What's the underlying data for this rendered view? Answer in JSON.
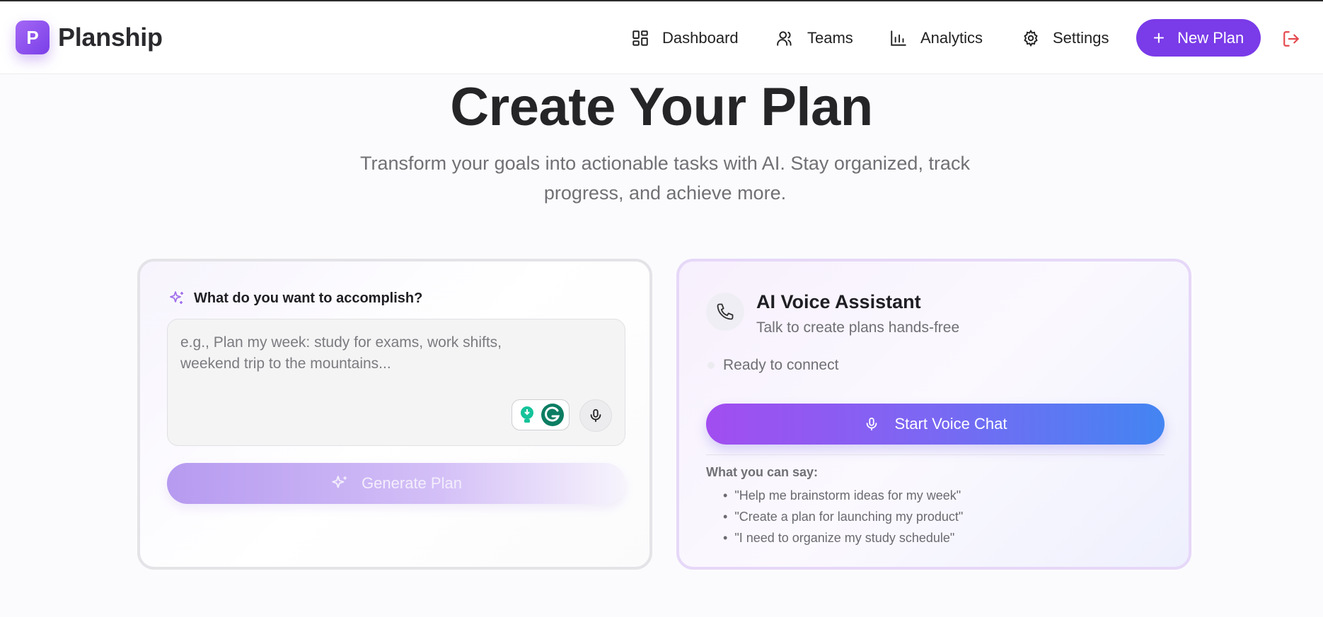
{
  "app": {
    "logo_letter": "P",
    "name": "Planship"
  },
  "nav": {
    "items": [
      {
        "label": "Dashboard",
        "icon": "dashboard-grid-icon"
      },
      {
        "label": "Teams",
        "icon": "users-icon"
      },
      {
        "label": "Analytics",
        "icon": "bar-chart-icon"
      },
      {
        "label": "Settings",
        "icon": "gear-icon"
      }
    ],
    "new_plan_label": "New Plan",
    "logout_icon": "logout-icon"
  },
  "hero": {
    "title": "Create Your Plan",
    "subtitle": "Transform your goals into actionable tasks with AI. Stay organized, track progress, and achieve more."
  },
  "plan_card": {
    "question": "What do you want to accomplish?",
    "placeholder": "e.g., Plan my week: study for exams, work shifts, weekend trip to the mountains...",
    "generate_label": "Generate Plan"
  },
  "voice_card": {
    "title": "AI Voice Assistant",
    "subtitle": "Talk to create plans hands-free",
    "status": "Ready to connect",
    "start_label": "Start Voice Chat",
    "say_label": "What you can say:",
    "examples": [
      "\"Help me brainstorm ideas for my week\"",
      "\"Create a plan for launching my product\"",
      "\"I need to organize my study schedule\""
    ]
  },
  "colors": {
    "brand_purple": "#7a3be8",
    "logout_red": "#e5484d",
    "voice_gradient_start": "#a24df0",
    "voice_gradient_end": "#4385f2"
  }
}
